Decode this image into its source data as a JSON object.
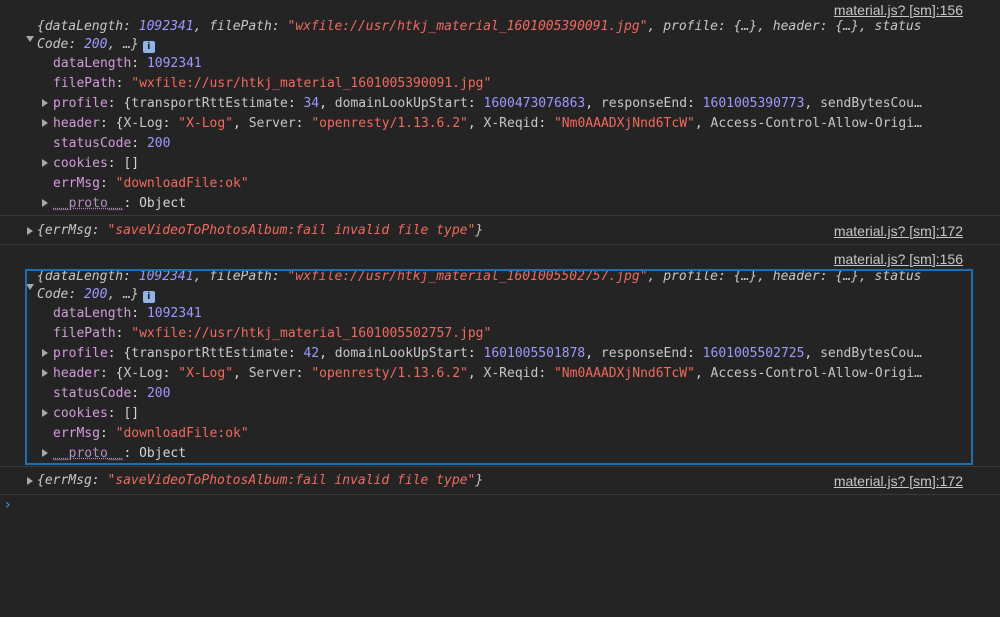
{
  "messages": [
    {
      "source": "material.js? [sm]:156",
      "summary_l1": {
        "open": "{",
        "k1": "dataLength",
        "v1": "1092341",
        "k2": "filePath",
        "v2": "\"wxfile://usr/htkj_material_1601005390091.jpg\"",
        "k3": "profile",
        "v3": "{…}",
        "k4": "header",
        "v4": "{…}",
        "k5": "status"
      },
      "summary_l2": {
        "k": "Code",
        "v": "200",
        "tail": ", …}"
      },
      "props": {
        "dataLength": {
          "k": "dataLength",
          "v": "1092341"
        },
        "filePath": {
          "k": "filePath",
          "v": "\"wxfile://usr/htkj_material_1601005390091.jpg\""
        },
        "profile": {
          "k": "profile",
          "a": "transportRttEstimate",
          "av": "34",
          "b": "domainLookUpStart",
          "bv": "1600473076863",
          "c": "responseEnd",
          "cv": "1601005390773",
          "d": "sendBytesCou…"
        },
        "header": {
          "k": "header",
          "a": "X-Log",
          "av": "\"X-Log\"",
          "b": "Server",
          "bv": "\"openresty/1.13.6.2\"",
          "c": "X-Reqid",
          "cv": "\"Nm0AAADXjNnd6TcW\"",
          "d": "Access-Control-Allow-Origi…"
        },
        "statusCode": {
          "k": "statusCode",
          "v": "200"
        },
        "cookies": {
          "k": "cookies",
          "v": "[]"
        },
        "errMsg": {
          "k": "errMsg",
          "v": "\"downloadFile:ok\""
        },
        "proto": {
          "k": "__proto__",
          "v": "Object"
        }
      }
    },
    {
      "source": "material.js? [sm]:172",
      "k": "errMsg",
      "v": "\"saveVideoToPhotosAlbum:fail invalid file type\""
    },
    {
      "source": "material.js? [sm]:156",
      "summary_l1": {
        "open": "{",
        "k1": "dataLength",
        "v1": "1092341",
        "k2": "filePath",
        "v2": "\"wxfile://usr/htkj_material_1601005502757.jpg\"",
        "k3": "profile",
        "v3": "{…}",
        "k4": "header",
        "v4": "{…}",
        "k5": "status"
      },
      "summary_l2": {
        "k": "Code",
        "v": "200",
        "tail": ", …}"
      },
      "props": {
        "dataLength": {
          "k": "dataLength",
          "v": "1092341"
        },
        "filePath": {
          "k": "filePath",
          "v": "\"wxfile://usr/htkj_material_1601005502757.jpg\""
        },
        "profile": {
          "k": "profile",
          "a": "transportRttEstimate",
          "av": "42",
          "b": "domainLookUpStart",
          "bv": "1601005501878",
          "c": "responseEnd",
          "cv": "1601005502725",
          "d": "sendBytesCou…"
        },
        "header": {
          "k": "header",
          "a": "X-Log",
          "av": "\"X-Log\"",
          "b": "Server",
          "bv": "\"openresty/1.13.6.2\"",
          "c": "X-Reqid",
          "cv": "\"Nm0AAADXjNnd6TcW\"",
          "d": "Access-Control-Allow-Origi…"
        },
        "statusCode": {
          "k": "statusCode",
          "v": "200"
        },
        "cookies": {
          "k": "cookies",
          "v": "[]"
        },
        "errMsg": {
          "k": "errMsg",
          "v": "\"downloadFile:ok\""
        },
        "proto": {
          "k": "__proto__",
          "v": "Object"
        }
      }
    },
    {
      "source": "material.js? [sm]:172",
      "k": "errMsg",
      "v": "\"saveVideoToPhotosAlbum:fail invalid file type\""
    }
  ],
  "prompt_glyph": "›",
  "info_glyph": "i",
  "colors": {
    "background": "#242424",
    "key": "#d49cdc",
    "number": "#9e99ff",
    "string": "#f28b54",
    "selection": "#1a6fb5"
  }
}
